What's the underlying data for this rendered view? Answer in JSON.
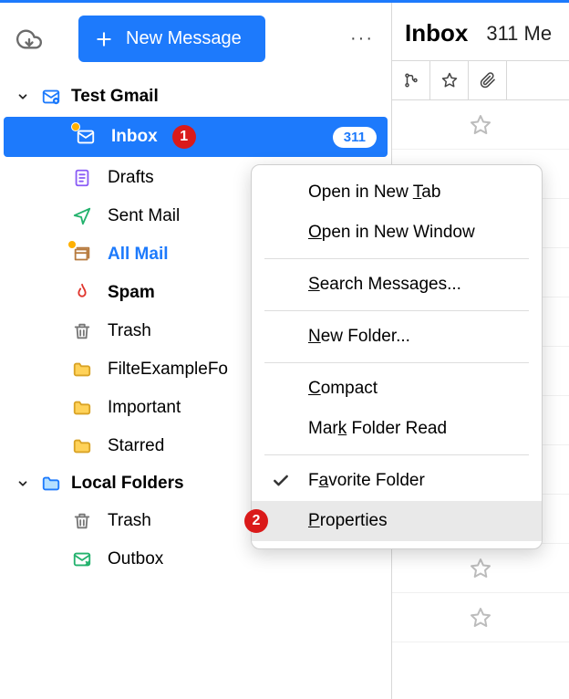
{
  "topbar": {
    "new_message": "New Message"
  },
  "accounts": [
    {
      "name": "Test Gmail",
      "folders": [
        {
          "id": "inbox",
          "label": "Inbox",
          "count": "311",
          "annotation": "1",
          "selected": true,
          "dot": true
        },
        {
          "id": "drafts",
          "label": "Drafts"
        },
        {
          "id": "sent",
          "label": "Sent Mail"
        },
        {
          "id": "allmail",
          "label": "All Mail",
          "emph_blue": true,
          "dot": true
        },
        {
          "id": "spam",
          "label": "Spam",
          "emph": true
        },
        {
          "id": "trash",
          "label": "Trash"
        },
        {
          "id": "custom1",
          "label": "FilteExampleFo"
        },
        {
          "id": "important",
          "label": "Important"
        },
        {
          "id": "starred",
          "label": "Starred"
        }
      ]
    },
    {
      "name": "Local Folders",
      "folders": [
        {
          "id": "ltrash",
          "label": "Trash"
        },
        {
          "id": "outbox",
          "label": "Outbox"
        }
      ]
    }
  ],
  "main": {
    "title": "Inbox",
    "subtitle": "311 Me"
  },
  "context_menu": {
    "items": [
      {
        "html": "Open in New <u>T</u>ab"
      },
      {
        "html": "<u>O</u>pen in New Window"
      },
      {
        "sep": true
      },
      {
        "html": "<u>S</u>earch Messages..."
      },
      {
        "sep": true
      },
      {
        "html": "<u>N</u>ew Folder..."
      },
      {
        "sep": true
      },
      {
        "html": "<u>C</u>ompact"
      },
      {
        "html": "Mar<u>k</u> Folder Read"
      },
      {
        "sep": true
      },
      {
        "html": "F<u>a</u>vorite Folder",
        "checked": true
      },
      {
        "html": "<u>P</u>roperties",
        "highlight": true,
        "annotation": "2"
      }
    ]
  }
}
